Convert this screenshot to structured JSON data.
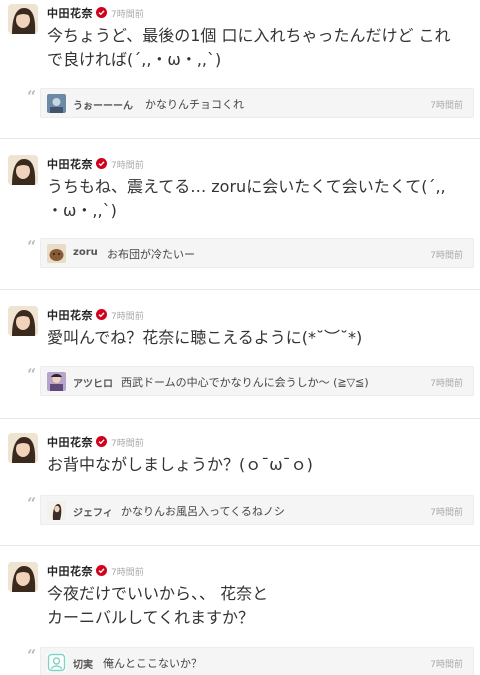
{
  "posts": [
    {
      "author": "中田花奈",
      "time": "7時間前",
      "line1": "今ちょうど、最後の1個 口に入れちゃったんだけど これ",
      "line2": "で良ければ(´,,・ω・,,`)",
      "reply": {
        "name": "うぉーーーん",
        "text": "かなりんチョコくれ",
        "time": "7時間前"
      }
    },
    {
      "author": "中田花奈",
      "time": "7時間前",
      "line1": "うちもね、震えてる… zoruに会いたくて会いたくて(´,,",
      "line2": "・ω・,,`)",
      "reply": {
        "name": "zoru",
        "text": "お布団が冷たいー",
        "time": "7時間前"
      }
    },
    {
      "author": "中田花奈",
      "time": "7時間前",
      "line1": "愛叫んでね？花奈に聴こえるように(*˘︶˘*)",
      "line2": "",
      "reply": {
        "name": "アツヒロ",
        "text": "西武ドームの中心でかなりんに会うしか～ (≧▽≦)",
        "time": "7時間前"
      }
    },
    {
      "author": "中田花奈",
      "time": "7時間前",
      "line1": "お背中ながしましょうか？(ｏ¯ω¯ｏ)",
      "line2": "",
      "reply": {
        "name": "ジェフィ",
        "text": "かなりんお風呂入ってくるねノシ",
        "time": "7時間前"
      }
    },
    {
      "author": "中田花奈",
      "time": "7時間前",
      "line1": "今夜だけでいいから、、 花奈と",
      "line2": "カーニバルしてくれますか？",
      "reply": {
        "name": "切実",
        "text": "俺んとここないか？",
        "time": "7時間前"
      }
    }
  ],
  "icons": {
    "author_avatar": "author-photo",
    "verified": "verified-badge-icon",
    "quote": "quote-icon"
  },
  "colors": {
    "verified": "#d0021b",
    "reply_bg": "#f5f5f5",
    "muted": "#aaaaaa"
  }
}
